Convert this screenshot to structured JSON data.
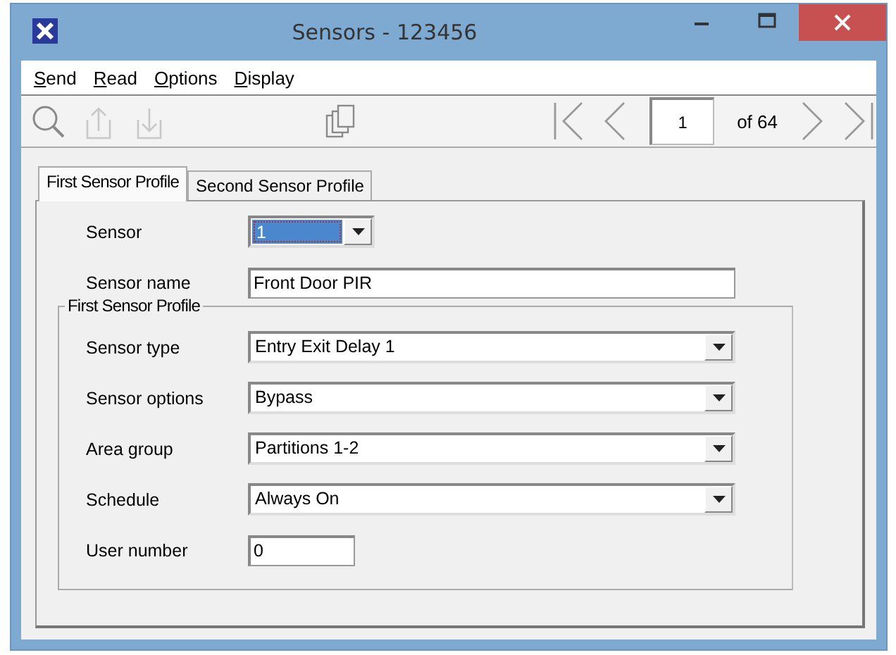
{
  "window": {
    "title": "Sensors - 123456"
  },
  "menu": [
    {
      "label": "Send"
    },
    {
      "label": "Read"
    },
    {
      "label": "Options"
    },
    {
      "label": "Display"
    }
  ],
  "toolbar": {
    "tools": [
      {
        "kind": "search",
        "disabled": false
      },
      {
        "kind": "upload",
        "disabled": true
      },
      {
        "kind": "download",
        "disabled": true
      },
      {
        "kind": "copy",
        "disabled": false
      }
    ],
    "page": "1",
    "page_count": "of 64"
  },
  "tabs": [
    {
      "label": "First Sensor Profile",
      "selected": true
    },
    {
      "label": "Second Sensor Profile",
      "selected": false
    }
  ],
  "fields": [
    {
      "label": "Sensor",
      "kind": "short-dropdown",
      "value": "1",
      "focused": true
    },
    {
      "label": "Sensor name",
      "kind": "text",
      "value": "Front Door PIR",
      "focused": false
    }
  ],
  "group": {
    "title": "First Sensor Profile",
    "fields": [
      {
        "label": "Sensor type",
        "kind": "dropdown",
        "value": "Entry Exit Delay 1",
        "focused": false
      },
      {
        "label": "Sensor options",
        "kind": "dropdown",
        "value": "Bypass",
        "focused": false
      },
      {
        "label": "Area group",
        "kind": "dropdown",
        "value": "Partitions 1-2",
        "focused": false
      },
      {
        "label": "Schedule",
        "kind": "dropdown",
        "value": "Always On",
        "focused": false
      },
      {
        "label": "User number",
        "kind": "short-text",
        "value": "0",
        "focused": false
      }
    ]
  }
}
